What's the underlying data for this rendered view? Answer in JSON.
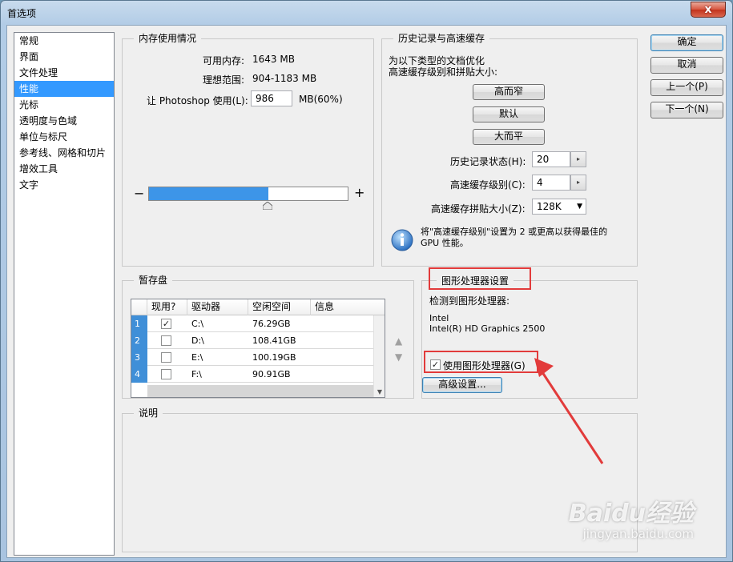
{
  "window": {
    "title": "首选项",
    "close_glyph": "x"
  },
  "sidebar": {
    "items": [
      {
        "label": "常规"
      },
      {
        "label": "界面"
      },
      {
        "label": "文件处理"
      },
      {
        "label": "性能",
        "selected": true
      },
      {
        "label": "光标"
      },
      {
        "label": "透明度与色域"
      },
      {
        "label": "单位与标尺"
      },
      {
        "label": "参考线、网格和切片"
      },
      {
        "label": "增效工具"
      },
      {
        "label": "文字"
      }
    ]
  },
  "memory": {
    "title": "内存使用情况",
    "available_label": "可用内存:",
    "available_value": "1643 MB",
    "ideal_label": "理想范围:",
    "ideal_value": "904-1183 MB",
    "use_label": "让 Photoshop 使用(L):",
    "use_value": "986",
    "use_unit": "MB(60%)",
    "minus": "−",
    "plus": "+",
    "slider_fraction": 0.6
  },
  "history": {
    "title": "历史记录与高速缓存",
    "desc_line1": "为以下类型的文档优化",
    "desc_line2": "高速缓存级别和拼贴大小:",
    "btn_tall": "高而窄",
    "btn_default": "默认",
    "btn_wide": "大而平",
    "states_label": "历史记录状态(H):",
    "states_value": "20",
    "cache_label": "高速缓存级别(C):",
    "cache_value": "4",
    "tile_label": "高速缓存拼贴大小(Z):",
    "tile_value": "128K",
    "info_line1": "将\"高速缓存级别\"设置为 2 或更高以获得最佳的",
    "info_line2": "GPU 性能。",
    "spin_glyph": "▸",
    "dropdown_glyph": "▼"
  },
  "scratch": {
    "title": "暂存盘",
    "columns": [
      "现用?",
      "驱动器",
      "空闲空间",
      "信息"
    ],
    "rows": [
      {
        "num": "1",
        "active": true,
        "drive": "C:\\",
        "space": "76.29GB"
      },
      {
        "num": "2",
        "active": false,
        "drive": "D:\\",
        "space": "108.41GB"
      },
      {
        "num": "3",
        "active": false,
        "drive": "E:\\",
        "space": "100.19GB"
      },
      {
        "num": "4",
        "active": false,
        "drive": "F:\\",
        "space": "90.91GB"
      }
    ],
    "check_glyph": "✓",
    "up_glyph": "▲",
    "down_glyph": "▼"
  },
  "gpu": {
    "title": "图形处理器设置",
    "detected_label": "检测到图形处理器:",
    "vendor": "Intel",
    "model": "Intel(R) HD Graphics 2500",
    "use_label": "使用图形处理器(G)",
    "use_checked": true,
    "advanced_button": "高级设置..."
  },
  "description": {
    "title": "说明"
  },
  "buttons": {
    "ok": "确定",
    "cancel": "取消",
    "prev": "上一个(P)",
    "next": "下一个(N)"
  },
  "watermark": {
    "brand": "Baidu经验",
    "url": "jingyan.baidu.com"
  },
  "colors": {
    "selection": "#3399ff",
    "slider_fill": "#3d95e8",
    "highlight_box": "#e23b3b"
  }
}
